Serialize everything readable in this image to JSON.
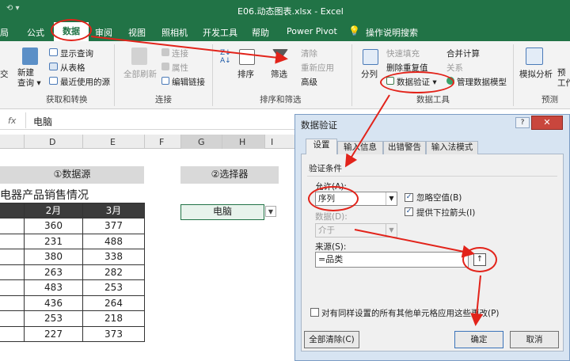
{
  "window": {
    "title": "E06.动态图表.xlsx  -  Excel",
    "quick_access": "⟲ ▾"
  },
  "ribbon_tabs": [
    "局",
    "公式",
    "数据",
    "审阅",
    "视图",
    "照相机",
    "开发工具",
    "帮助",
    "Power Pivot",
    "操作说明搜索"
  ],
  "ribbon": {
    "get_transform": {
      "new_query": "新建\n查询 ▾",
      "show_queries": "显示查询",
      "from_table": "从表格",
      "recent_sources": "最近使用的源",
      "group_label": "获取和转换",
      "left_edge": "交"
    },
    "connections": {
      "refresh_all": "全部刷新",
      "connections": "连接",
      "properties": "属性",
      "edit_links": "编辑链接",
      "group_label": "连接"
    },
    "sort_filter": {
      "sort": "排序",
      "filter": "筛选",
      "clear": "清除",
      "reapply": "重新应用",
      "advanced": "高级",
      "group_label": "排序和筛选",
      "az_small": "Z↓ A↓"
    },
    "data_tools": {
      "split": "分列",
      "flash_fill": "快速填充",
      "remove_duplicates": "删除重复值",
      "data_validation": "数据验证 ▾",
      "consolidate": "合并计算",
      "relationships": "关系",
      "manage_model": "管理数据模型",
      "group_label": "数据工具"
    },
    "forecast": {
      "what_if": "模拟分析",
      "forecast_sheet": "预\n工作",
      "group_label": "预测"
    }
  },
  "formula_bar": {
    "fx": "fx",
    "value": "电脑"
  },
  "columns": [
    "D",
    "E",
    "F",
    "G",
    "H",
    "I"
  ],
  "sheet": {
    "data_source_header": "①数据源",
    "selector_header": "②选择器",
    "table_title": "电器产品销售情况",
    "table_headers": [
      "2月",
      "3月"
    ],
    "table_rows": [
      [
        "360",
        "377"
      ],
      [
        "231",
        "488"
      ],
      [
        "380",
        "338"
      ],
      [
        "263",
        "282"
      ],
      [
        "483",
        "253"
      ],
      [
        "436",
        "264"
      ],
      [
        "253",
        "218"
      ],
      [
        "227",
        "373"
      ]
    ],
    "selector_value": "电脑"
  },
  "dialog": {
    "title": "数据验证",
    "help": "?",
    "close": "✕",
    "tabs": [
      "设置",
      "输入信息",
      "出错警告",
      "输入法模式"
    ],
    "criteria_label": "验证条件",
    "allow_label": "允许(A):",
    "allow_value": "序列",
    "ignore_blank": "忽略空值(B)",
    "in_cell_dropdown": "提供下拉箭头(I)",
    "data_label": "数据(D):",
    "data_value": "介于",
    "source_label": "来源(S):",
    "source_value": "=品类",
    "source_button": "↑",
    "apply_all": "对有同样设置的所有其他单元格应用这些更改(P)",
    "clear_all": "全部清除(C)",
    "ok": "确定",
    "cancel": "取消"
  },
  "colors": {
    "excel_green": "#217346",
    "annotation_red": "#e2231a"
  }
}
